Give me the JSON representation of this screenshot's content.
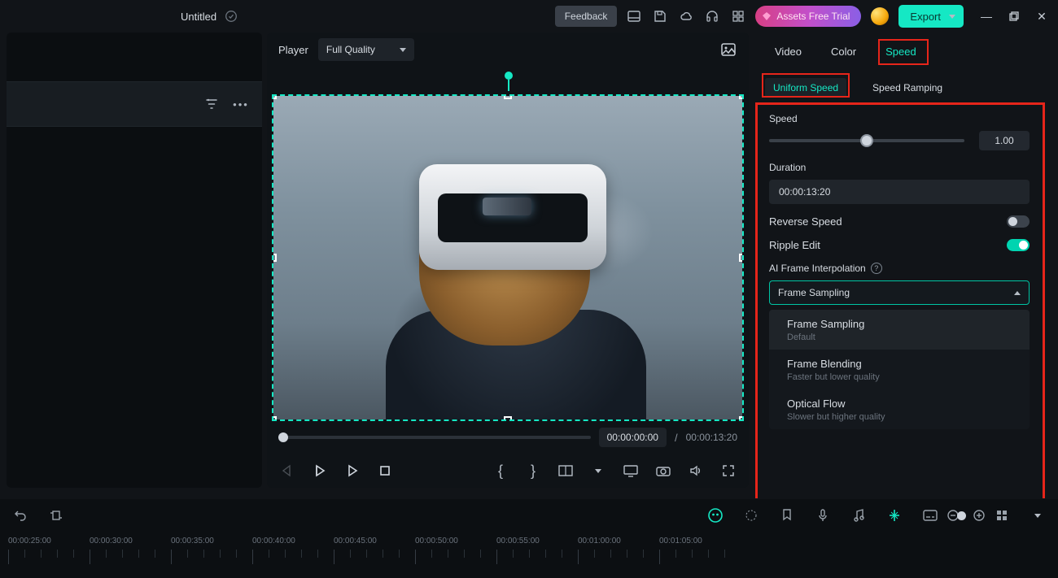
{
  "titlebar": {
    "project_name": "Untitled",
    "feedback": "Feedback",
    "assets_trial": "Assets Free Trial",
    "export": "Export"
  },
  "player": {
    "label": "Player",
    "quality": "Full Quality",
    "current_time": "00:00:00:00",
    "separator": "/",
    "total_time": "00:00:13:20"
  },
  "right_panel": {
    "tabs": {
      "video": "Video",
      "color": "Color",
      "speed": "Speed"
    },
    "subtabs": {
      "uniform": "Uniform Speed",
      "ramping": "Speed Ramping"
    },
    "speed": {
      "label": "Speed",
      "value": "1.00",
      "slider_pct": 50
    },
    "duration": {
      "label": "Duration",
      "value": "00:00:13:20"
    },
    "reverse": {
      "label": "Reverse Speed",
      "state": "off"
    },
    "ripple": {
      "label": "Ripple Edit",
      "state": "on"
    },
    "ai_interp": {
      "label": "AI Frame Interpolation",
      "selected": "Frame Sampling",
      "options": [
        {
          "title": "Frame Sampling",
          "sub": "Default",
          "selected": true
        },
        {
          "title": "Frame Blending",
          "sub": "Faster but lower quality",
          "selected": false
        },
        {
          "title": "Optical Flow",
          "sub": "Slower but higher quality",
          "selected": false
        }
      ]
    }
  },
  "timeline": {
    "labels": [
      "00:00:25:00",
      "00:00:30:00",
      "00:00:35:00",
      "00:00:40:00",
      "00:00:45:00",
      "00:00:50:00",
      "00:00:55:00",
      "00:01:00:00",
      "00:01:05:00"
    ]
  }
}
